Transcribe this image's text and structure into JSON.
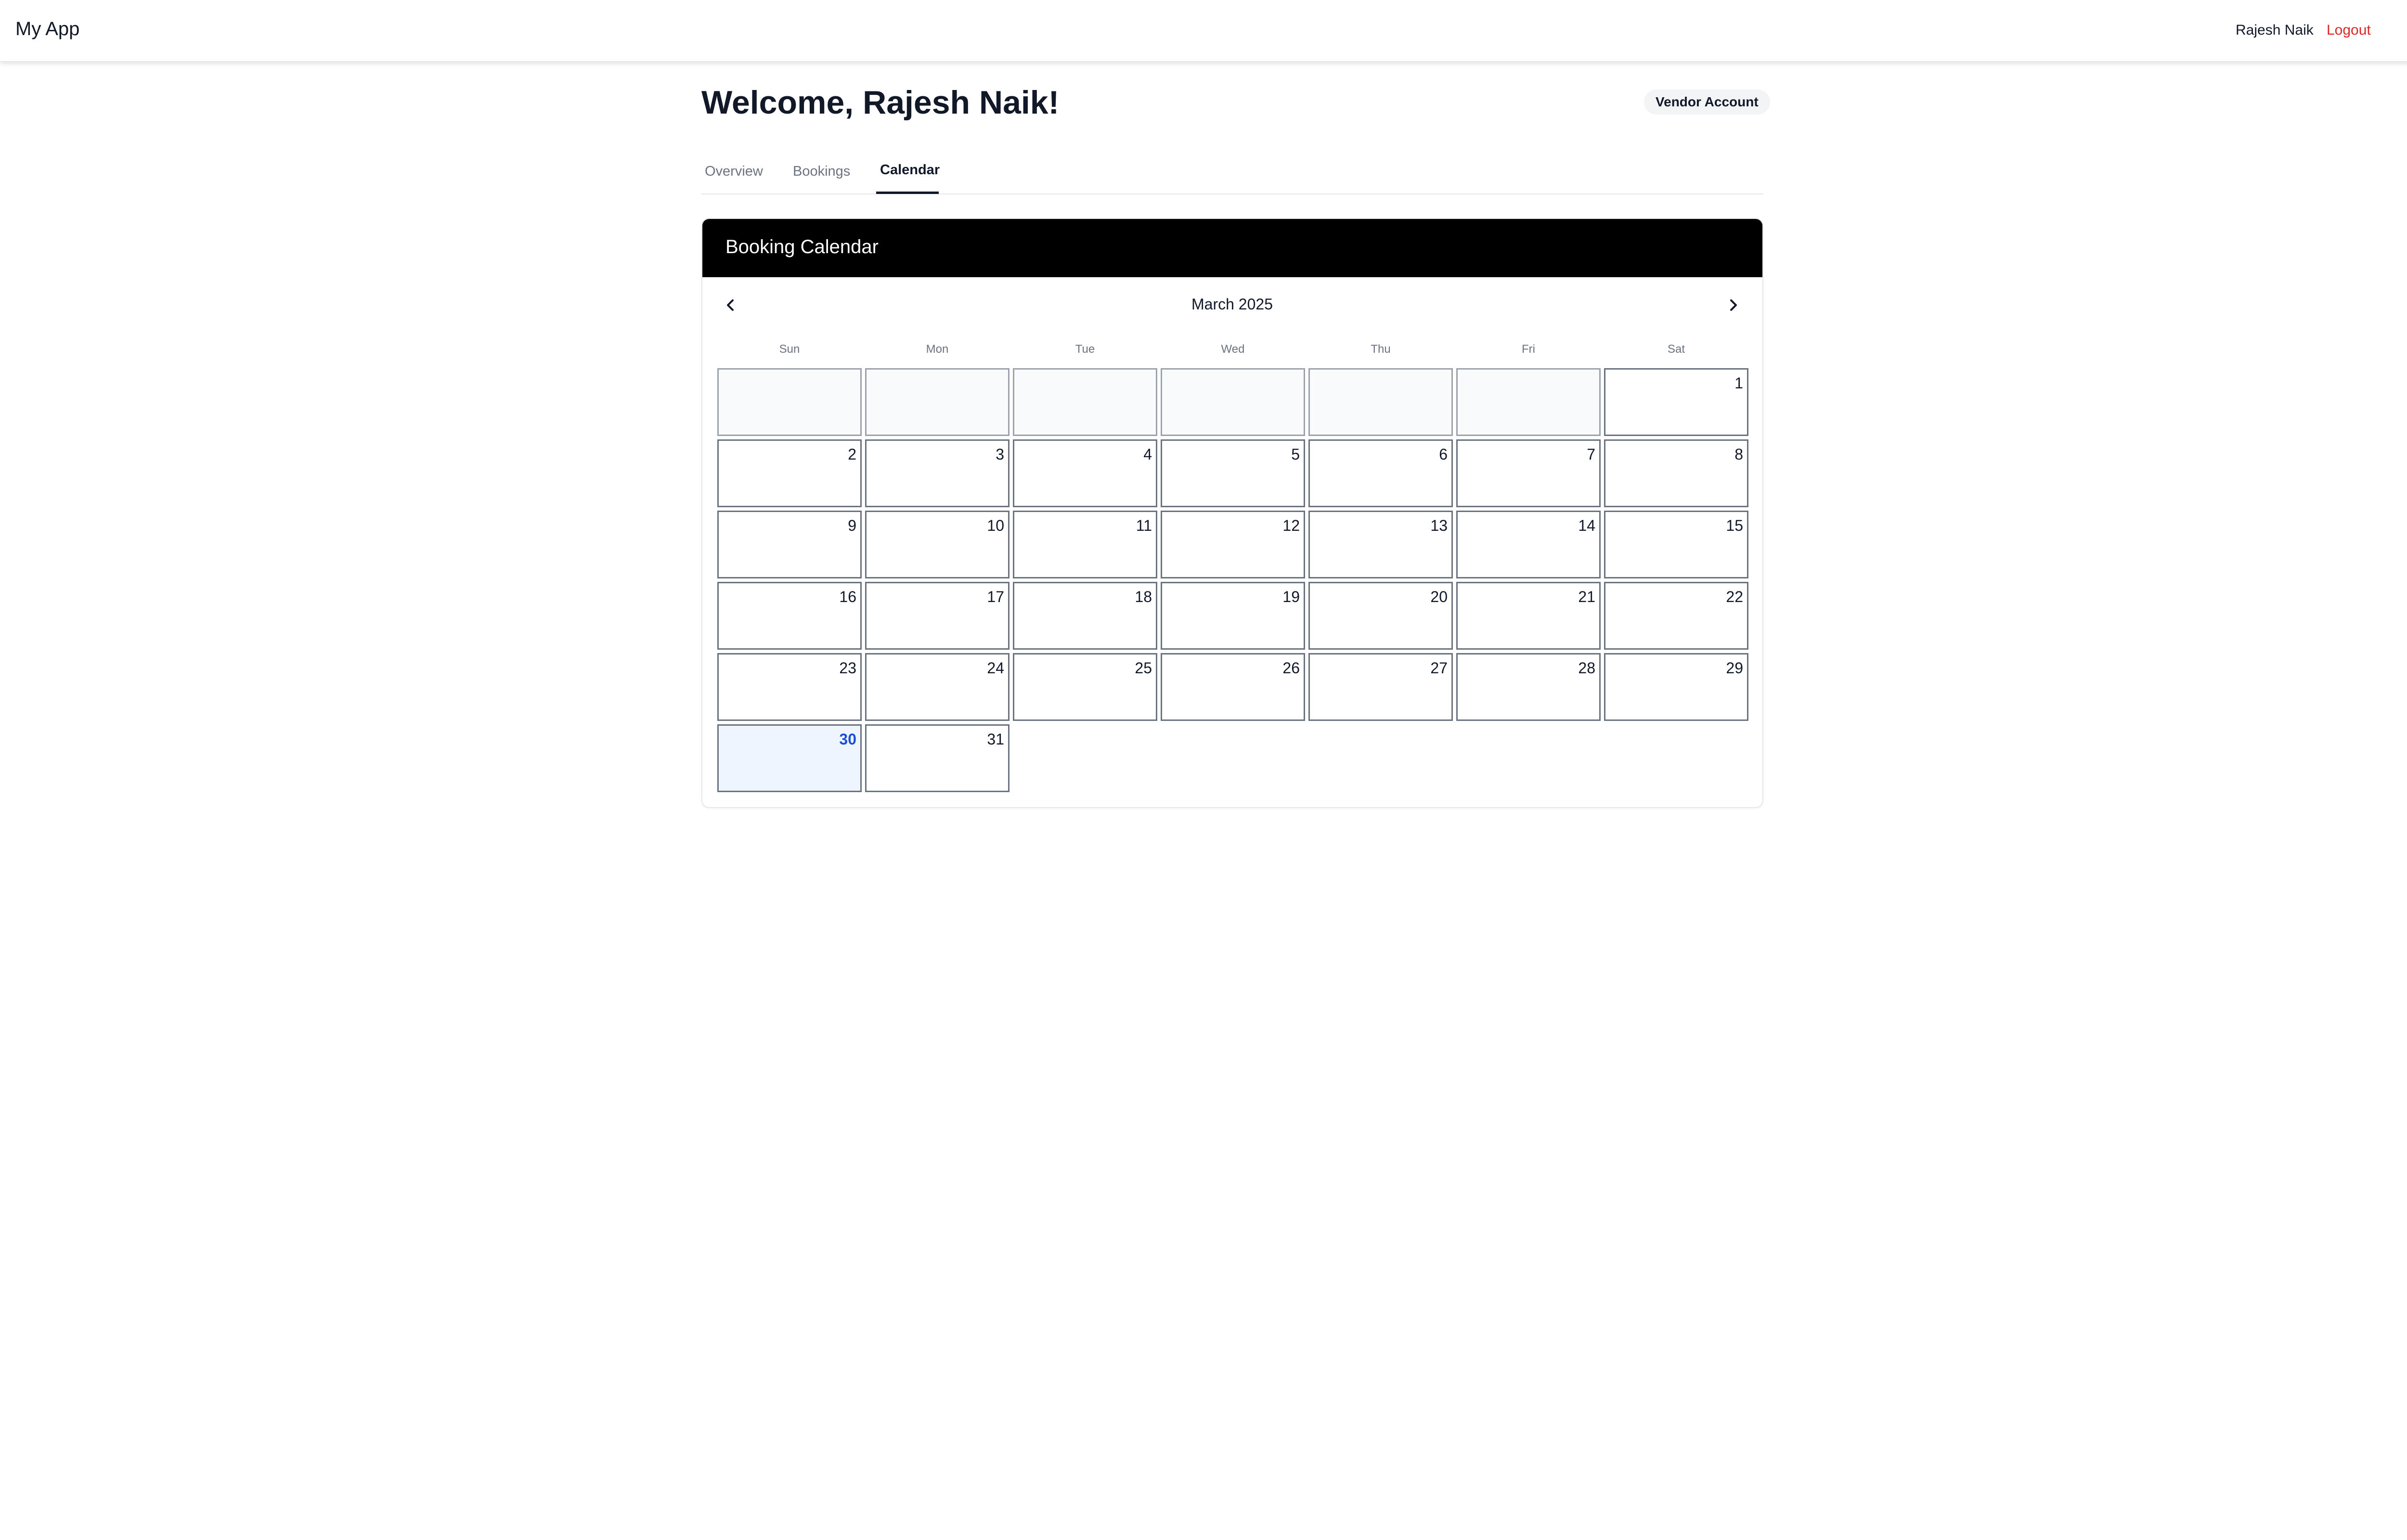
{
  "app": {
    "title": "My App"
  },
  "nav": {
    "user_name": "Rajesh Naik",
    "logout_label": "Logout",
    "logo_icon": "diamond-logo-icon"
  },
  "header": {
    "welcome": "Welcome, Rajesh Naik!",
    "account_badge": "Vendor Account"
  },
  "tabs": [
    {
      "label": "Overview",
      "active": false
    },
    {
      "label": "Bookings",
      "active": false
    },
    {
      "label": "Calendar",
      "active": true
    }
  ],
  "calendar": {
    "title": "Booking Calendar",
    "month_label": "March 2025",
    "weekdays": [
      "Sun",
      "Mon",
      "Tue",
      "Wed",
      "Thu",
      "Fri",
      "Sat"
    ],
    "leading_empty_days": 6,
    "days": [
      "1",
      "2",
      "3",
      "4",
      "5",
      "6",
      "7",
      "8",
      "9",
      "10",
      "11",
      "12",
      "13",
      "14",
      "15",
      "16",
      "17",
      "18",
      "19",
      "20",
      "21",
      "22",
      "23",
      "24",
      "25",
      "26",
      "27",
      "28",
      "29",
      "30",
      "31"
    ],
    "today": "30"
  },
  "colors": {
    "accent": "#000000",
    "logout": "#dc2626",
    "today_bg": "#eef5ff",
    "today_text": "#1d4ed8"
  }
}
